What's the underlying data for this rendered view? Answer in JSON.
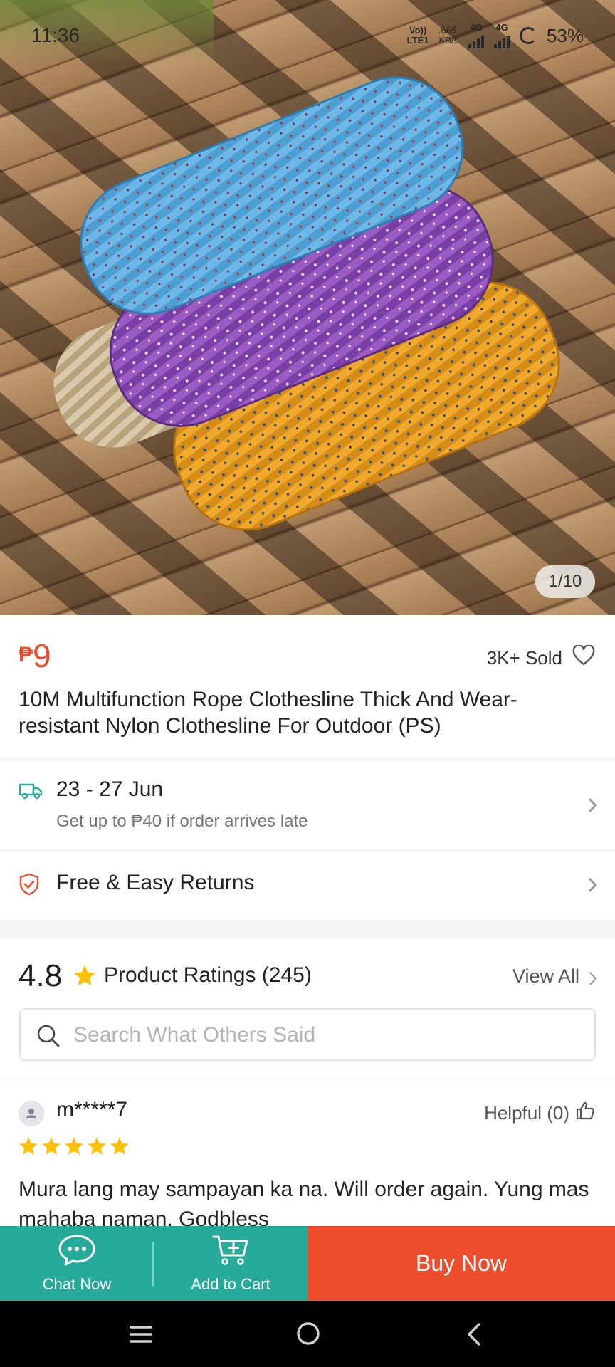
{
  "status_bar": {
    "time": "11:36",
    "volte": "Vo))",
    "lte": "LTE1",
    "speed_value": "665",
    "speed_unit": "KB/s",
    "sim1": "4G",
    "sim2": "4G",
    "battery": "53%"
  },
  "gallery": {
    "counter": "1/10"
  },
  "product": {
    "currency": "₱",
    "price": "9",
    "sold": "3K+ Sold",
    "title": "10M Multifunction Rope Clothesline Thick And Wear-resistant Nylon Clothesline For Outdoor (PS)"
  },
  "shipping": {
    "dates": "23 - 27 Jun",
    "guarantee": "Get up to ₱40 if order arrives late"
  },
  "returns": {
    "label": "Free & Easy Returns"
  },
  "ratings": {
    "score": "4.8",
    "label": "Product Ratings (245)",
    "view_all": "View All"
  },
  "review_search": {
    "placeholder": "Search What Others Said"
  },
  "review": {
    "user": "m*****7",
    "helpful": "Helpful (0)",
    "stars": 5,
    "text": "Mura lang may sampayan ka na. Will order again. Yung mas mahaba naman. Godbless"
  },
  "actions": {
    "chat": "Chat Now",
    "cart": "Add to Cart",
    "buy": "Buy Now"
  },
  "colors": {
    "primary_orange": "#ee4d2d",
    "teal": "#26aa99",
    "star_yellow": "#ffc107"
  }
}
